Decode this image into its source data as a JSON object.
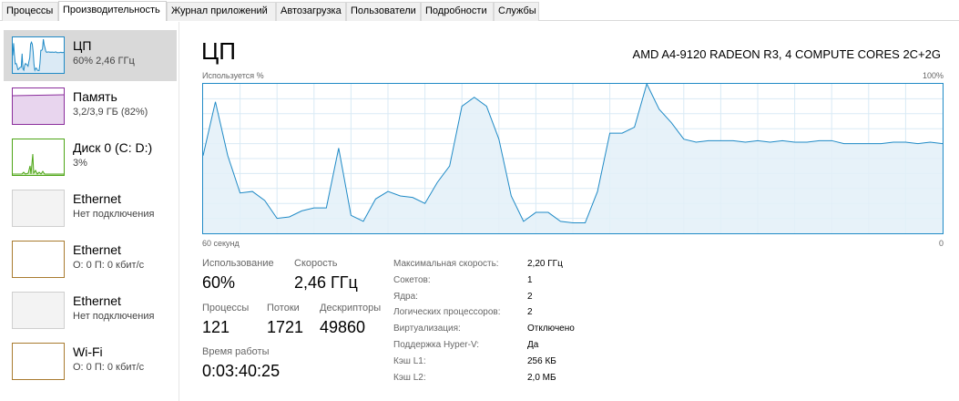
{
  "tabs": [
    {
      "label": "Процессы"
    },
    {
      "label": "Производительность"
    },
    {
      "label": "Журнал приложений"
    },
    {
      "label": "Автозагрузка"
    },
    {
      "label": "Пользователи"
    },
    {
      "label": "Подробности"
    },
    {
      "label": "Службы"
    }
  ],
  "sidebar": {
    "items": [
      {
        "name": "ЦП",
        "sub": "60% 2,46 ГГц",
        "color": "#1f8ac6"
      },
      {
        "name": "Память",
        "sub": "3,2/3,9 ГБ (82%)",
        "color": "#8b2e9c"
      },
      {
        "name": "Диск 0 (C: D:)",
        "sub": "3%",
        "color": "#4da516"
      },
      {
        "name": "Ethernet",
        "sub": "Нет подключения",
        "color": "#bdbdbd"
      },
      {
        "name": "Ethernet",
        "sub": "О: 0 П: 0 кбит/с",
        "color": "#a97b2f"
      },
      {
        "name": "Ethernet",
        "sub": "Нет подключения",
        "color": "#bdbdbd"
      },
      {
        "name": "Wi-Fi",
        "sub": "О: 0 П: 0 кбит/с",
        "color": "#a97b2f"
      }
    ]
  },
  "main": {
    "title": "ЦП",
    "model": "AMD A4-9120 RADEON R3, 4 COMPUTE CORES 2C+2G",
    "graph_top_left": "Используется %",
    "graph_top_right": "100%",
    "graph_bottom_left": "60 секунд",
    "graph_bottom_right": "0",
    "stats": {
      "usage_label": "Использование",
      "usage_value": "60%",
      "speed_label": "Скорость",
      "speed_value": "2,46 ГГц",
      "processes_label": "Процессы",
      "processes_value": "121",
      "threads_label": "Потоки",
      "threads_value": "1721",
      "handles_label": "Дескрипторы",
      "handles_value": "49860",
      "uptime_label": "Время работы",
      "uptime_value": "0:03:40:25"
    },
    "details": [
      {
        "key": "Максимальная скорость:",
        "value": "2,20 ГГц"
      },
      {
        "key": "Сокетов:",
        "value": "1"
      },
      {
        "key": "Ядра:",
        "value": "2"
      },
      {
        "key": "Логических процессоров:",
        "value": "2"
      },
      {
        "key": "Виртуализация:",
        "value": "Отключено"
      },
      {
        "key": "Поддержка Hyper-V:",
        "value": "Да"
      },
      {
        "key": "Кэш L1:",
        "value": "256 КБ"
      },
      {
        "key": "Кэш L2:",
        "value": "2,0 МБ"
      }
    ]
  },
  "chart_data": {
    "type": "area",
    "x_range_seconds": [
      60,
      0
    ],
    "ylim": [
      0,
      100
    ],
    "grid": true,
    "color": "#1f8ac6",
    "values": [
      52,
      88,
      52,
      27,
      28,
      22,
      10,
      11,
      15,
      17,
      17,
      57,
      12,
      8,
      23,
      28,
      25,
      24,
      20,
      34,
      45,
      85,
      91,
      85,
      63,
      25,
      8,
      14,
      14,
      8,
      7,
      7,
      28,
      67,
      67,
      71,
      100,
      83,
      74,
      63,
      61,
      62,
      62,
      62,
      61,
      62,
      61,
      62,
      61,
      61,
      62,
      62,
      60,
      60,
      60,
      60,
      61,
      61,
      60,
      61,
      60
    ]
  }
}
